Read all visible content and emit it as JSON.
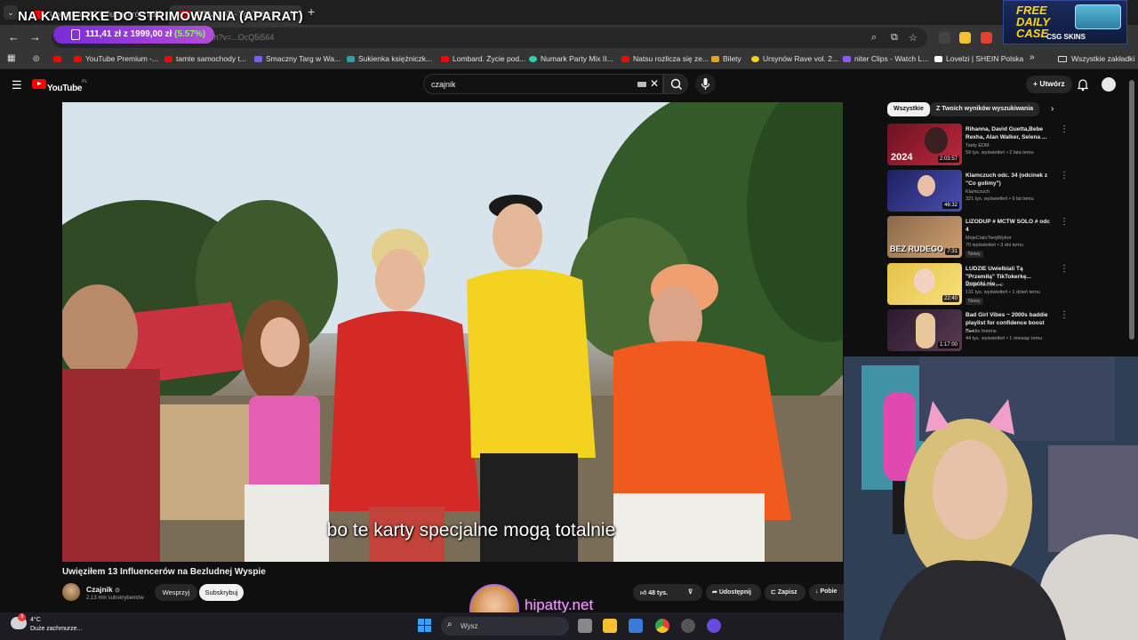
{
  "stream": {
    "overlay_title": "NA KAMERKE DO STRIMOWANIA (APARAT)",
    "watermark_url": "hipatty.net"
  },
  "browser": {
    "tabs": [
      {
        "label": "Uwięziłem 13 Influencerów na"
      },
      {
        "label": "CZAJ LAT - YouTube"
      }
    ],
    "url_text": "youtube.com/watch?v=...OcQ5i564",
    "price_extension": {
      "current": "111,41 zł",
      "target": "1999,00 zł",
      "percent": "(5.57%)"
    },
    "bookmarks": [
      {
        "label": "YouTube Premium -...",
        "color": "#ff0000"
      },
      {
        "label": "tamte samochody t...",
        "color": "#ff0000"
      },
      {
        "label": "Smaczny Targ w Wa...",
        "color": "#7a5cff"
      },
      {
        "label": "Sukienka księżniczk...",
        "color": "#2ea0a0"
      },
      {
        "label": "Lombard. Życie pod...",
        "color": "#ff0000"
      },
      {
        "label": "Numark Party Mix II...",
        "color": "#2fd1b0"
      },
      {
        "label": "Natsu rozlicza się ze...",
        "color": "#ff0000"
      },
      {
        "label": "Bilety",
        "color": "#e8a020"
      },
      {
        "label": "Ursynów Rave vol. 2...",
        "color": "#f5d020"
      },
      {
        "label": "niter Clips - Watch L...",
        "color": "#8a5cff"
      },
      {
        "label": "Lovelzi | SHEIN Polska",
        "color": "#ffffff"
      }
    ],
    "bookmarks_overflow": "»",
    "all_bookmarks_label": "Wszystkie zakładki"
  },
  "ad": {
    "line1": "FREE",
    "line2": "DAILY",
    "line3": "CASE",
    "brand": "CSG SKINS"
  },
  "youtube": {
    "logo_text": "YouTube",
    "country_code": "PL",
    "search_value": "czajnik",
    "create_label": "Utwórz",
    "video": {
      "caption": "bo te karty specjalne mogą totalnie",
      "title": "Uwięziłem 13 Influencerów na Bezludnej Wyspie",
      "channel_name": "Czajnik",
      "subscribers": "2,13 mln subskrybentów",
      "join_label": "Wesprzyj",
      "subscribe_label": "Subskrybuj",
      "likes": "48 tys.",
      "share_label": "Udostępnij",
      "save_label": "Zapisz",
      "download_label": "Pobie"
    },
    "filter_chips": [
      {
        "label": "Wszystkie"
      },
      {
        "label": "Z Twoich wyników wyszukiwania"
      }
    ],
    "recommendations": [
      {
        "title": "Rihanna, David Guetta,Bebe Rexha, Alan Walker, Selena ...",
        "channel": "Tasty EDM",
        "meta": "59 tys. wyświetleń • 2 lata temu",
        "duration": "2:03:57",
        "badge": "",
        "thumb_color": "#9a1b2e",
        "thumb_text": "2024"
      },
      {
        "title": "Klamczuch odc. 34 (odcinek z \"Co golimy\")",
        "channel": "Klamczuch",
        "meta": "321 tys. wyświetleń • 9 lat temu",
        "duration": "46:32",
        "badge": "",
        "thumb_color": "#2d2f7a",
        "thumb_text": ""
      },
      {
        "title": "LIZODUP # MCTW SOLO # odc 4",
        "channel": "MojeCialoTwojWybor",
        "meta": "70 wyświetleń • 3 dni temu",
        "duration": "7:31",
        "badge": "Nowy",
        "thumb_color": "#b07a4a",
        "thumb_text": "BEZ RUDEGO"
      },
      {
        "title": "LUDZIE Uwielbiali Tą \"Przemiłą\" TikTokerkę... Dopóki nie ...",
        "channel": "Świat Internetu",
        "meta": "131 tys. wyświetleń • 1 dzień temu",
        "duration": "22:40",
        "badge": "Nowy",
        "thumb_color": "#e6c34a",
        "thumb_text": ""
      },
      {
        "title": "Bad Girl Vibes ~ 2000s baddie playlist for confidence boost ~...",
        "channel": "baddie femme",
        "meta": "44 tys. wyświetleń • 1 miesiąc temu",
        "duration": "1:17:00",
        "badge": "",
        "thumb_color": "#3a2440",
        "thumb_text": ""
      }
    ]
  },
  "taskbar": {
    "weather_badge": "3",
    "temperature": "4°C",
    "weather_desc": "Duże zachmurze...",
    "search_placeholder": "Wysz"
  }
}
